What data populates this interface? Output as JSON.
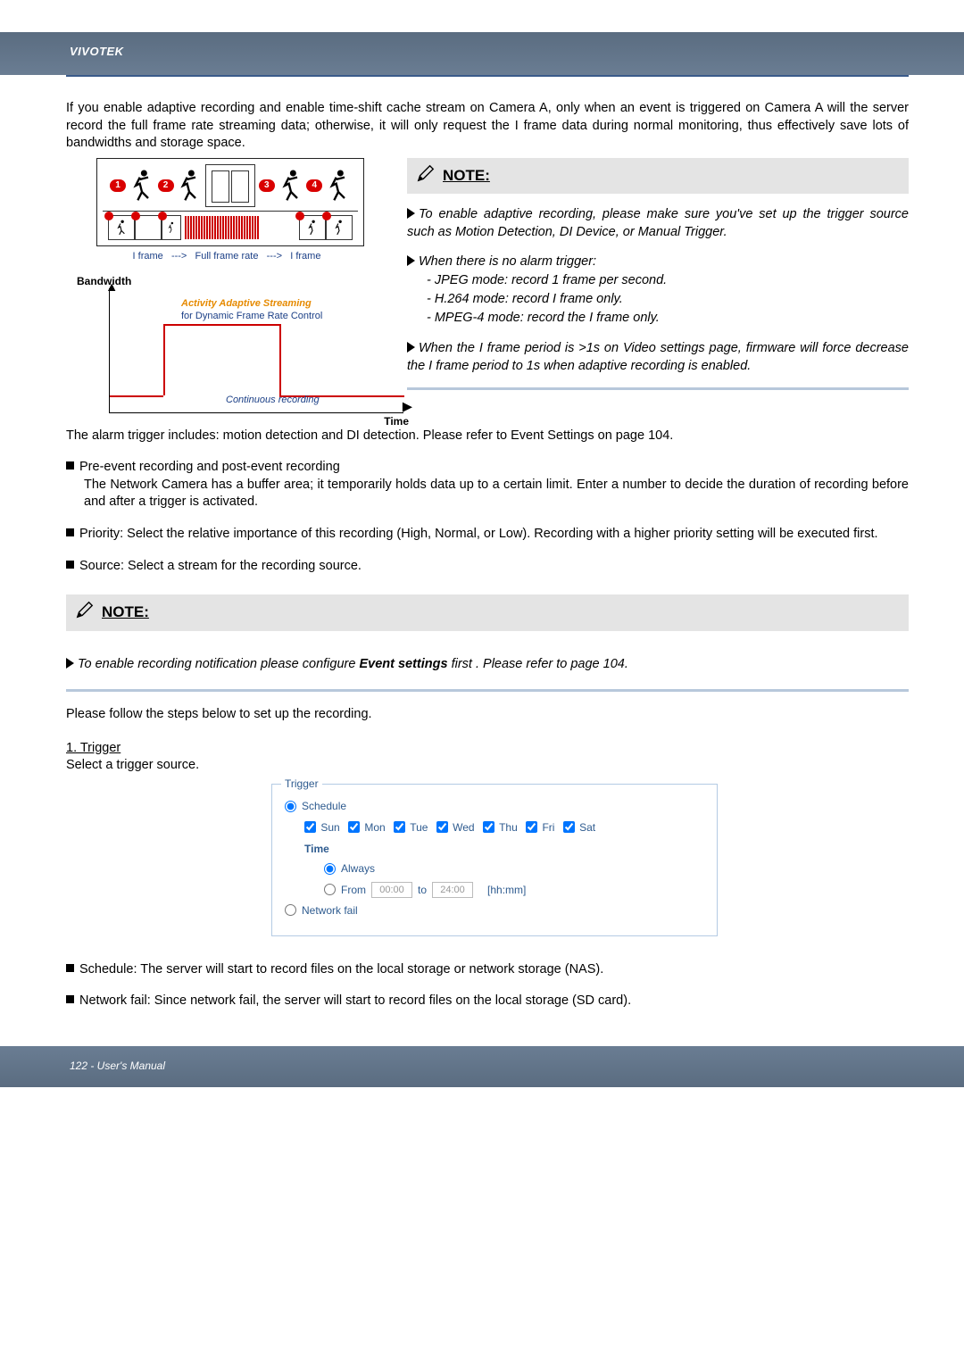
{
  "header": {
    "brand": "VIVOTEK"
  },
  "intro": "If you enable adaptive recording and enable time-shift cache stream on Camera A, only when an event is triggered on Camera A will the server record the full frame rate streaming data; otherwise, it will only request the I frame data during normal monitoring, thus effectively save lots of bandwidths and storage space.",
  "diagram": {
    "numbers": [
      "1",
      "2",
      "3",
      "4"
    ],
    "caption_left": "I frame",
    "caption_arrow": "--->",
    "caption_mid": "Full frame rate",
    "caption_right": "I frame",
    "bandwidth_label": "Bandwidth",
    "aas_line1": "Activity Adaptive Streaming",
    "aas_line2": "for Dynamic Frame Rate Control",
    "continuous": "Continuous recording",
    "time_label": "Time"
  },
  "note1": {
    "title": "NOTE:",
    "item1": "To enable adaptive recording, please make sure you've set up the trigger source such as Motion Detection, DI Device, or Manual Trigger.",
    "item2_head": "When there is no alarm trigger:",
    "item2_a": "- JPEG mode: record 1 frame per second.",
    "item2_b": "- H.264 mode: record I frame only.",
    "item2_c": "- MPEG-4 mode: record the I frame only.",
    "item3": "When the I frame period is >1s on Video settings page, firmware will force decrease the I frame period to 1s when adaptive recording is enabled."
  },
  "after_note": "The alarm trigger includes: motion detection and DI detection. Please refer to Event Settings on page 104.",
  "bullets": {
    "b1_head": "Pre-event recording and post-event recording",
    "b1_body": "The Network Camera has a buffer area; it temporarily holds data up to a certain limit. Enter a number to decide the duration of recording before and after a trigger is activated.",
    "b2": "Priority: Select the relative importance of this recording (High, Normal, or Low). Recording with a higher priority setting will be executed first.",
    "b3": "Source: Select a stream for the recording source."
  },
  "note2": {
    "title": "NOTE:",
    "line_pre": "To enable recording notification please configure ",
    "line_es": "Event settings",
    "line_post": " first . Please refer to page 104."
  },
  "steps_intro": "Please follow the steps below to set up the recording.",
  "trigger_section": {
    "heading": "1. Trigger",
    "sub": "Select a trigger source.",
    "legend": "Trigger",
    "schedule": "Schedule",
    "days": [
      "Sun",
      "Mon",
      "Tue",
      "Wed",
      "Thu",
      "Fri",
      "Sat"
    ],
    "time_label": "Time",
    "always": "Always",
    "from": "From",
    "from_val": "00:00",
    "to": "to",
    "to_val": "24:00",
    "hhmm": "[hh:mm]",
    "network_fail": "Network fail"
  },
  "trailing": {
    "b1": "Schedule: The server will start to record files on the local storage or network storage (NAS).",
    "b2": "Network fail: Since network fail, the server will start to record files on the local storage (SD card)."
  },
  "footer": {
    "text": "122 - User's Manual"
  }
}
